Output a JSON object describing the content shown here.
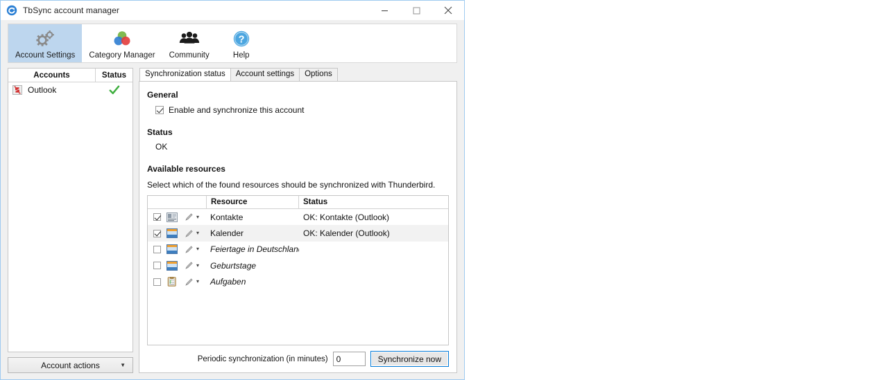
{
  "window": {
    "title": "TbSync account manager",
    "app_icon": "sync-circle-icon",
    "controls": {
      "minimize": "minimize-icon",
      "maximize": "maximize-icon",
      "close": "close-icon"
    }
  },
  "toolbar": {
    "items": [
      {
        "label": "Account Settings",
        "icon": "gears-icon",
        "selected": true
      },
      {
        "label": "Category Manager",
        "icon": "color-circles-icon",
        "selected": false
      },
      {
        "label": "Community",
        "icon": "people-icon",
        "selected": false
      },
      {
        "label": "Help",
        "icon": "question-mark-icon",
        "selected": false
      }
    ]
  },
  "accounts_panel": {
    "headers": {
      "name": "Accounts",
      "status": "Status"
    },
    "rows": [
      {
        "name": "Outlook",
        "icon": "eas-provider-icon",
        "status_icon": "green-check-icon"
      }
    ],
    "actions_button": {
      "label": "Account actions",
      "caret": "▼"
    }
  },
  "tabs": [
    {
      "label": "Synchronization status",
      "active": true
    },
    {
      "label": "Account settings",
      "active": false
    },
    {
      "label": "Options",
      "active": false
    }
  ],
  "panel": {
    "general": {
      "title": "General",
      "checkbox": {
        "label": "Enable and synchronize this account",
        "checked": true
      }
    },
    "status": {
      "title": "Status",
      "value": "OK"
    },
    "resources": {
      "title": "Available resources",
      "description": "Select which of the found resources should be synchronized with Thunderbird.",
      "headers": {
        "controls": "",
        "resource": "Resource",
        "status": "Status"
      },
      "rows": [
        {
          "checked": true,
          "type_icon": "contacts-card-icon",
          "edit_icon": "pencil-icon",
          "name": "Kontakte",
          "italic": false,
          "status": "OK: Kontakte (Outlook)",
          "alt": false
        },
        {
          "checked": true,
          "type_icon": "calendar-icon",
          "edit_icon": "pencil-icon",
          "name": "Kalender",
          "italic": false,
          "status": "OK: Kalender (Outlook)",
          "alt": true
        },
        {
          "checked": false,
          "type_icon": "calendar-icon",
          "edit_icon": "pencil-icon",
          "name": "Feiertage in Deutschland",
          "italic": true,
          "status": "",
          "alt": false
        },
        {
          "checked": false,
          "type_icon": "calendar-icon",
          "edit_icon": "pencil-icon",
          "name": "Geburtstage",
          "italic": true,
          "status": "",
          "alt": false
        },
        {
          "checked": false,
          "type_icon": "tasks-clipboard-icon",
          "edit_icon": "pencil-icon",
          "name": "Aufgaben",
          "italic": true,
          "status": "",
          "alt": false
        }
      ]
    },
    "footer": {
      "periodic_label": "Periodic synchronization (in minutes)",
      "periodic_value": "0",
      "sync_button": "Synchronize now"
    }
  },
  "colors": {
    "window_border": "#9ecaf0",
    "toolbar_selected": "#bdd6ee",
    "focus_blue": "#0078d7",
    "status_green": "#3faf3f",
    "row_alt": "#f2f2f2"
  }
}
